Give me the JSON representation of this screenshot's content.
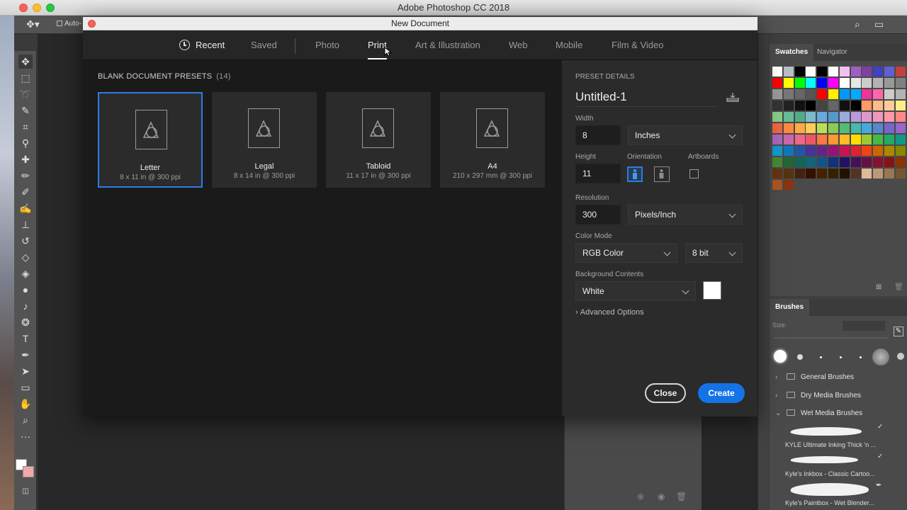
{
  "app": {
    "title": "Adobe Photoshop CC 2018",
    "options_bar": {
      "auto_select_label": "Auto-"
    }
  },
  "dialog": {
    "title": "New Document",
    "tabs": [
      {
        "label": "Recent",
        "active": false
      },
      {
        "label": "Saved",
        "active": false
      },
      {
        "label": "Photo",
        "active": false
      },
      {
        "label": "Print",
        "active": true
      },
      {
        "label": "Art & Illustration",
        "active": false
      },
      {
        "label": "Web",
        "active": false
      },
      {
        "label": "Mobile",
        "active": false
      },
      {
        "label": "Film & Video",
        "active": false
      }
    ],
    "presets_section": {
      "title": "BLANK DOCUMENT PRESETS",
      "count": "(14)",
      "items": [
        {
          "name": "Letter",
          "size": "8 x 11 in @ 300 ppi",
          "selected": true
        },
        {
          "name": "Legal",
          "size": "8 x 14 in @ 300 ppi",
          "selected": false
        },
        {
          "name": "Tabloid",
          "size": "11 x 17 in @ 300 ppi",
          "selected": false
        },
        {
          "name": "A4",
          "size": "210 x 297 mm @ 300 ppi",
          "selected": false
        }
      ]
    },
    "preset_details": {
      "heading": "PRESET DETAILS",
      "name": "Untitled-1",
      "width_label": "Width",
      "width_value": "8",
      "units": "Inches",
      "height_label": "Height",
      "height_value": "11",
      "orientation_label": "Orientation",
      "artboards_label": "Artboards",
      "resolution_label": "Resolution",
      "resolution_value": "300",
      "resolution_units": "Pixels/Inch",
      "color_mode_label": "Color Mode",
      "color_mode": "RGB Color",
      "bit_depth": "8 bit",
      "background_label": "Background Contents",
      "background": "White",
      "background_color": "#ffffff",
      "advanced_options": "Advanced Options"
    },
    "buttons": {
      "close": "Close",
      "create": "Create"
    }
  },
  "panels": {
    "swatches_tab": "Swatches",
    "navigator_tab": "Navigator",
    "brushes_tab": "Brushes",
    "brush_size_label": "Size:",
    "brush_folders": [
      {
        "label": "General Brushes",
        "expanded": false
      },
      {
        "label": "Dry Media Brushes",
        "expanded": false
      },
      {
        "label": "Wet Media Brushes",
        "expanded": true
      }
    ],
    "brush_items": [
      "KYLE Ultimate Inking Thick 'n ...",
      "Kyle's Inkbox - Classic Cartoo...",
      "Kyle's Paintbox - Wet Blender..."
    ]
  },
  "colors": {
    "accent": "#2d7be5",
    "create_button": "#1473e6"
  }
}
